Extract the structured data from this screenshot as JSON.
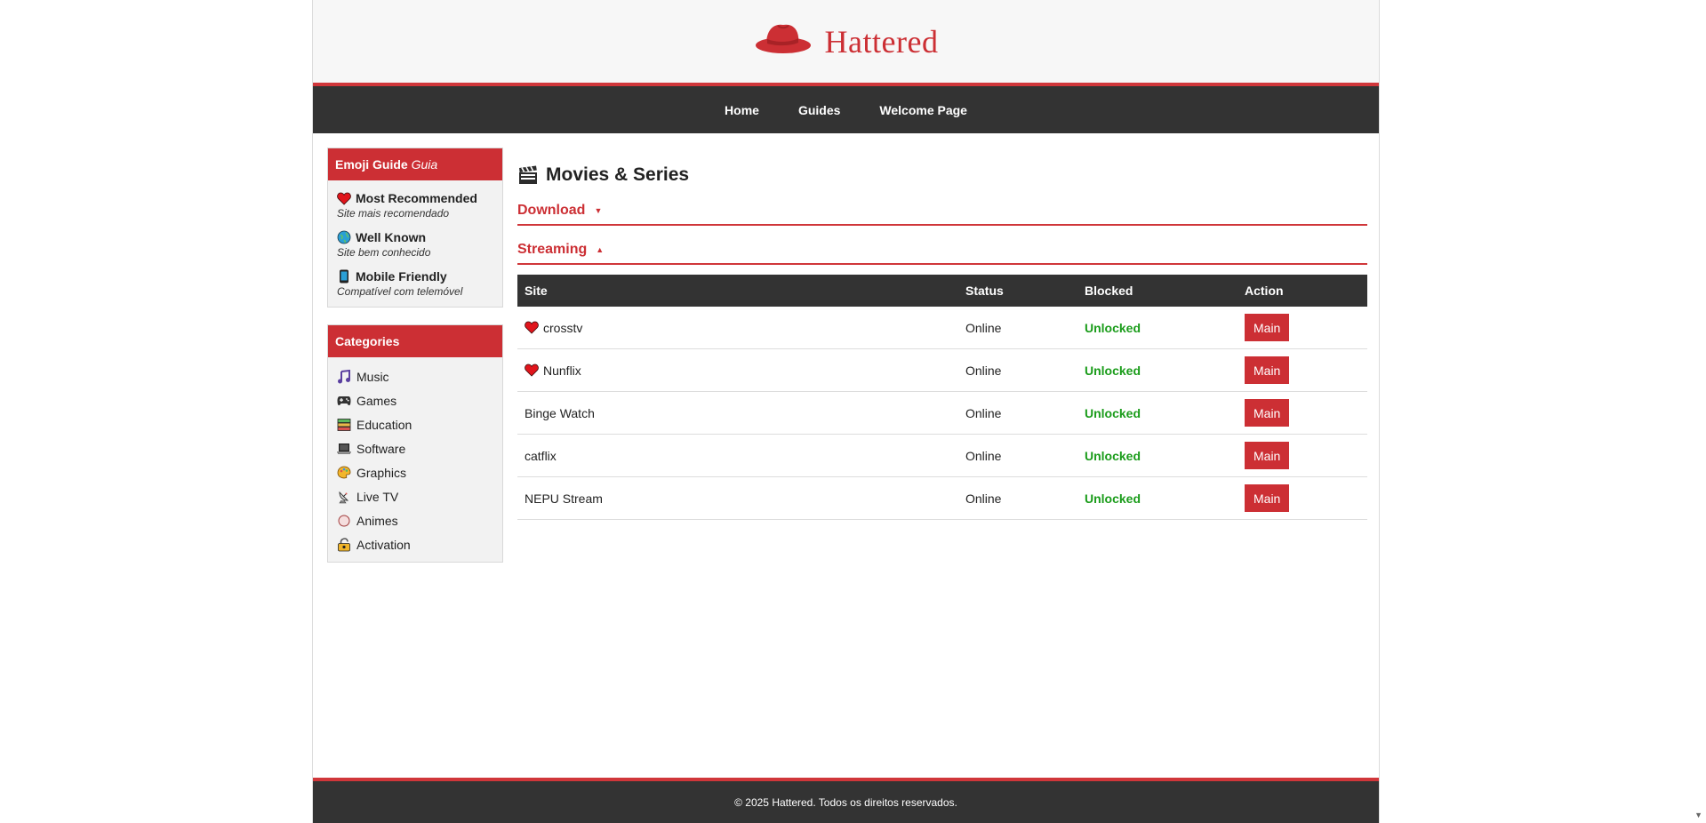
{
  "brand": {
    "name": "Hattered",
    "logo_icon": "fedora-hat-icon",
    "accent": "#cc2f34"
  },
  "nav": {
    "items": [
      "Home",
      "Guides",
      "Welcome Page"
    ]
  },
  "sidebar": {
    "guide": {
      "title": "Emoji Guide",
      "title_suffix": "Guia",
      "items": [
        {
          "icon": "heart-icon",
          "title": "Most Recommended",
          "subtitle": "Site mais recomendado"
        },
        {
          "icon": "globe-icon",
          "title": "Well Known",
          "subtitle": "Site bem conhecido"
        },
        {
          "icon": "mobile-phone-icon",
          "title": "Mobile Friendly",
          "subtitle": "Compatível com telemóvel"
        }
      ]
    },
    "categories": {
      "title": "Categories",
      "items": [
        {
          "icon": "music-note-icon",
          "label": "Music"
        },
        {
          "icon": "gamepad-icon",
          "label": "Games"
        },
        {
          "icon": "books-icon",
          "label": "Education"
        },
        {
          "icon": "laptop-icon",
          "label": "Software"
        },
        {
          "icon": "palette-icon",
          "label": "Graphics"
        },
        {
          "icon": "satellite-antenna-icon",
          "label": "Live TV"
        },
        {
          "icon": "circle-icon",
          "label": "Animes"
        },
        {
          "icon": "key-lock-icon",
          "label": "Activation"
        }
      ]
    }
  },
  "main": {
    "title": "Movies & Series",
    "title_icon": "clapperboard-icon",
    "sections": [
      {
        "label": "Download",
        "caret": "▼"
      },
      {
        "label": "Streaming",
        "caret": "▲"
      }
    ],
    "table": {
      "headers": {
        "site": "Site",
        "status": "Status",
        "blocked": "Blocked",
        "action": "Action"
      },
      "rows": [
        {
          "site": "crosstv",
          "recommended": true,
          "status": "Online",
          "blocked": "Unlocked",
          "action": "Main"
        },
        {
          "site": "Nunflix",
          "recommended": true,
          "status": "Online",
          "blocked": "Unlocked",
          "action": "Main"
        },
        {
          "site": "Binge Watch",
          "recommended": false,
          "status": "Online",
          "blocked": "Unlocked",
          "action": "Main"
        },
        {
          "site": "catflix",
          "recommended": false,
          "status": "Online",
          "blocked": "Unlocked",
          "action": "Main"
        },
        {
          "site": "NEPU Stream",
          "recommended": false,
          "status": "Online",
          "blocked": "Unlocked",
          "action": "Main"
        }
      ]
    }
  },
  "footer": {
    "text": "© 2025 Hattered. Todos os direitos reservados."
  }
}
